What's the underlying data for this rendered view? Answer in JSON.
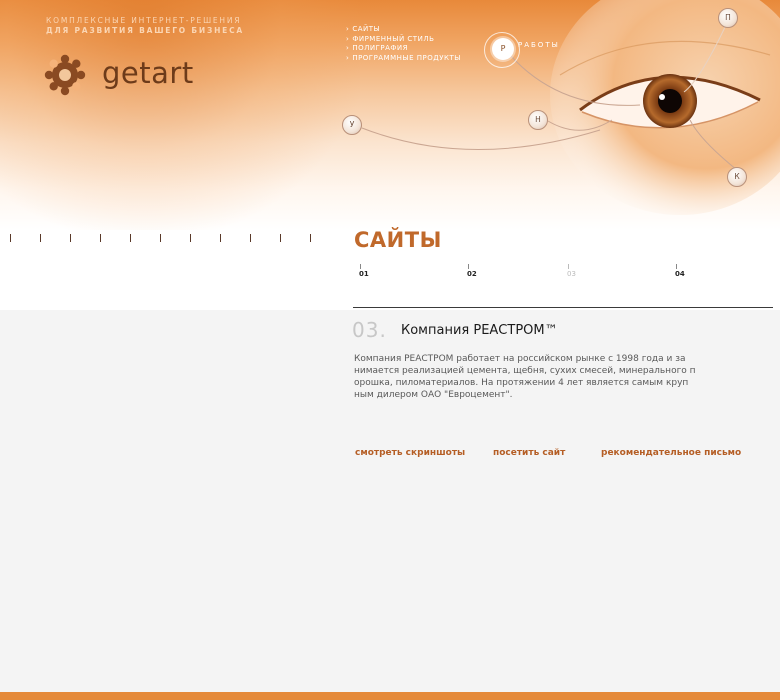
{
  "header": {
    "tagline_line1": "КОМПЛЕКСНЫЕ ИНТЕРНЕТ-РЕШЕНИЯ",
    "tagline_line2": "ДЛЯ РАЗВИТИЯ ВАШЕГО БИЗНЕСА",
    "logo_text": "getart",
    "logo_icon": "gear-logo-icon"
  },
  "topnav": {
    "items": [
      {
        "label": "САЙТЫ"
      },
      {
        "label": "ФИРМЕННЫЙ СТИЛЬ"
      },
      {
        "label": "ПОЛИГРАФИЯ"
      },
      {
        "label": "ПРОГРАММНЫЕ ПРОДУКТЫ"
      }
    ]
  },
  "work": {
    "letter": "Р",
    "label": "РАБОТЫ"
  },
  "nodes": {
    "p": "П",
    "u": "У",
    "n": "Н",
    "k": "К"
  },
  "section": {
    "title": "САЙТЫ"
  },
  "pager": {
    "items": [
      {
        "label": "01",
        "active": false
      },
      {
        "label": "02",
        "active": false
      },
      {
        "label": "03",
        "active": true
      },
      {
        "label": "04",
        "active": false
      }
    ]
  },
  "item": {
    "number": "03.",
    "title": "Компания РЕАСТРОМ™",
    "description": "Компания РЕАСТРОМ работает на российском рынке с 1998 года и за нимается реализацией цемента, щебня, сухих смесей, минерального п орошка, пиломатериалов. На протяжении 4 лет является самым круп ным дилером ОАО \"Евроцемент\"."
  },
  "links": {
    "screenshots": "смотреть скриншоты",
    "visit": "посетить сайт",
    "letter": "рекомендательное письмо"
  },
  "colors": {
    "accent": "#c0692b",
    "orange": "#e58a3a",
    "link": "#b55e25",
    "logo_brown": "#6d3b1a"
  }
}
